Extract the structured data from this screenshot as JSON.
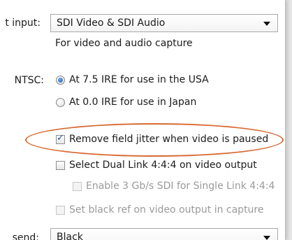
{
  "input": {
    "label": "t input:",
    "value": "SDI Video & SDI Audio",
    "hint": "For video and audio capture"
  },
  "ntsc": {
    "label": "NTSC:",
    "options": [
      {
        "label": "At 7.5 IRE for use in the USA",
        "selected": true
      },
      {
        "label": "At 0.0 IRE for use in Japan",
        "selected": false
      }
    ]
  },
  "checks": {
    "remove_jitter": {
      "label": "Remove field jitter when video is paused",
      "checked": true,
      "enabled": true
    },
    "dual_link": {
      "label": "Select Dual Link 4:4:4 on video output",
      "checked": false,
      "enabled": true
    },
    "enable_3g": {
      "label": "Enable 3 Gb/s SDI for Single Link 4:4:4",
      "checked": false,
      "enabled": false
    },
    "black_ref": {
      "label": "Set black ref on video output in capture",
      "checked": false,
      "enabled": false
    }
  },
  "send": {
    "label": "send:",
    "value": "Black"
  },
  "colors": {
    "highlight": "#d86a33",
    "accent": "#1f5fb5"
  }
}
